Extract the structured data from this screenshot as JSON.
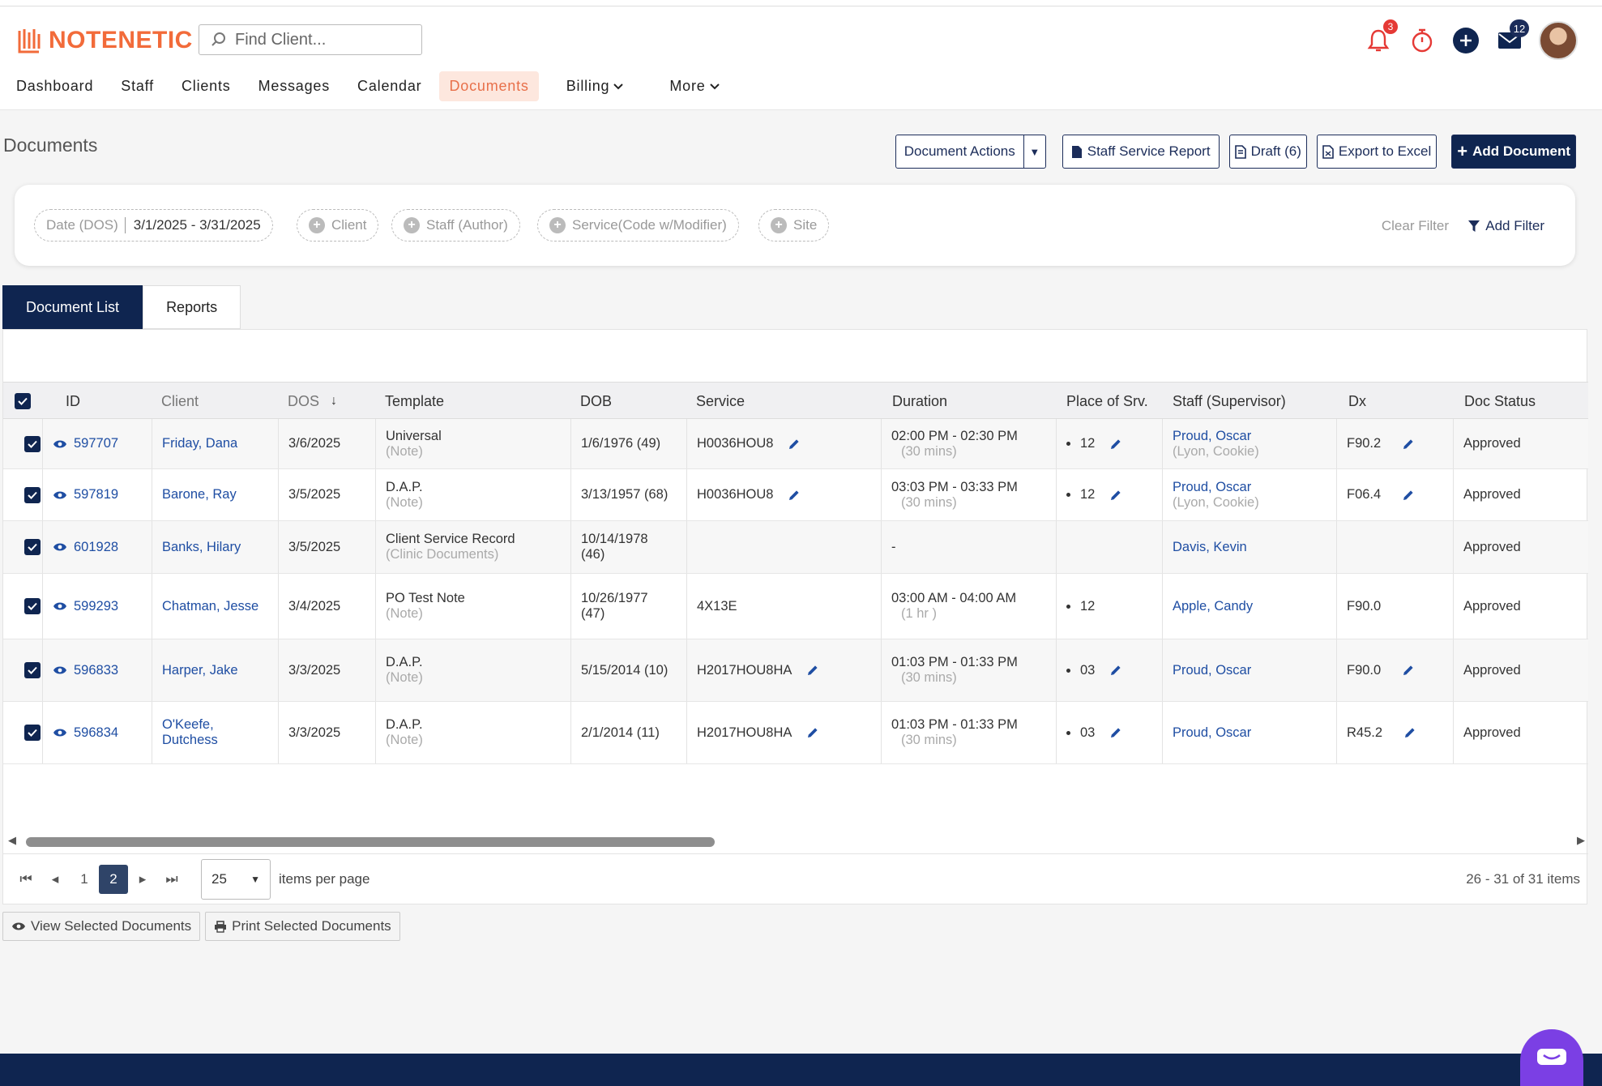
{
  "app": {
    "logo_text": "NOTENETIC",
    "brand_color": "#f26b3a",
    "accent": "#0f2550"
  },
  "search": {
    "placeholder": "Find Client..."
  },
  "nav": {
    "dashboard": "Dashboard",
    "staff": "Staff",
    "clients": "Clients",
    "messages": "Messages",
    "calendar": "Calendar",
    "documents": "Documents",
    "billing": "Billing",
    "more": "More"
  },
  "top_icons": {
    "notifications_count": "3",
    "mail_count": "12"
  },
  "page": {
    "title": "Documents"
  },
  "actions": {
    "document_actions": "Document Actions",
    "staff_service_report": "Staff Service Report",
    "draft": "Draft (6)",
    "export": "Export to Excel",
    "add_document": "Add Document"
  },
  "filters": {
    "date_label": "Date (DOS)",
    "date_value": "3/1/2025 - 3/31/2025",
    "client": "Client",
    "staff": "Staff (Author)",
    "service": "Service(Code w/Modifier)",
    "site": "Site",
    "clear": "Clear Filter",
    "add": "Add Filter"
  },
  "tabs": {
    "list": "Document List",
    "reports": "Reports"
  },
  "columns": {
    "id": "ID",
    "client": "Client",
    "dos": "DOS",
    "template": "Template",
    "dob": "DOB",
    "service": "Service",
    "duration": "Duration",
    "place": "Place of Srv.",
    "staff": "Staff (Supervisor)",
    "dx": "Dx",
    "status": "Doc Status"
  },
  "rows": [
    {
      "id": "597707",
      "client": "Friday, Dana",
      "dos": "3/6/2025",
      "template": "Universal",
      "template_sub": "(Note)",
      "dob": "1/6/1976 (49)",
      "service": "H0036HOU8",
      "duration": "02:00 PM - 02:30 PM",
      "duration_sub": "(30 mins)",
      "place": "12",
      "staff": "Proud, Oscar",
      "staff_sub": "(Lyon, Cookie)",
      "dx": "F90.2",
      "status": "Approved"
    },
    {
      "id": "597819",
      "client": "Barone, Ray",
      "dos": "3/5/2025",
      "template": "D.A.P.",
      "template_sub": "(Note)",
      "dob": "3/13/1957 (68)",
      "service": "H0036HOU8",
      "duration": "03:03 PM - 03:33 PM",
      "duration_sub": "(30 mins)",
      "place": "12",
      "staff": "Proud, Oscar",
      "staff_sub": "(Lyon, Cookie)",
      "dx": "F06.4",
      "status": "Approved"
    },
    {
      "id": "601928",
      "client": "Banks, Hilary",
      "dos": "3/5/2025",
      "template": "Client Service Record",
      "template_sub": "(Clinic Documents)",
      "dob": "10/14/1978",
      "dob_sub": "(46)",
      "service": "",
      "duration": "-",
      "duration_sub": "",
      "place": "",
      "staff": "Davis, Kevin",
      "staff_sub": "",
      "dx": "",
      "status": "Approved"
    },
    {
      "id": "599293",
      "client": "Chatman, Jesse",
      "dos": "3/4/2025",
      "template": "PO Test Note",
      "template_sub": "(Note)",
      "dob": "10/26/1977",
      "dob_sub": "(47)",
      "service": "4X13E",
      "duration": "03:00 AM - 04:00 AM",
      "duration_sub": "(1 hr )",
      "place": "12",
      "staff": "Apple, Candy",
      "staff_sub": "",
      "dx": "F90.0",
      "status": "Approved"
    },
    {
      "id": "596833",
      "client": "Harper, Jake",
      "dos": "3/3/2025",
      "template": "D.A.P.",
      "template_sub": "(Note)",
      "dob": "5/15/2014 (10)",
      "service": "H2017HOU8HA",
      "duration": "01:03 PM - 01:33 PM",
      "duration_sub": "(30 mins)",
      "place": "03",
      "staff": "Proud, Oscar",
      "staff_sub": "",
      "dx": "F90.0",
      "status": "Approved"
    },
    {
      "id": "596834",
      "client": "O'Keefe,",
      "client2": "Dutchess",
      "dos": "3/3/2025",
      "template": "D.A.P.",
      "template_sub": "(Note)",
      "dob": "2/1/2014 (11)",
      "service": "H2017HOU8HA",
      "duration": "01:03 PM - 01:33 PM",
      "duration_sub": "(30 mins)",
      "place": "03",
      "staff": "Proud, Oscar",
      "staff_sub": "",
      "dx": "R45.2",
      "status": "Approved"
    }
  ],
  "pager": {
    "page1": "1",
    "page2": "2",
    "page_size": "25",
    "per_page": "items per page",
    "info": "26 - 31 of 31 items"
  },
  "bottom": {
    "view": "View Selected Documents",
    "print": "Print Selected Documents"
  }
}
